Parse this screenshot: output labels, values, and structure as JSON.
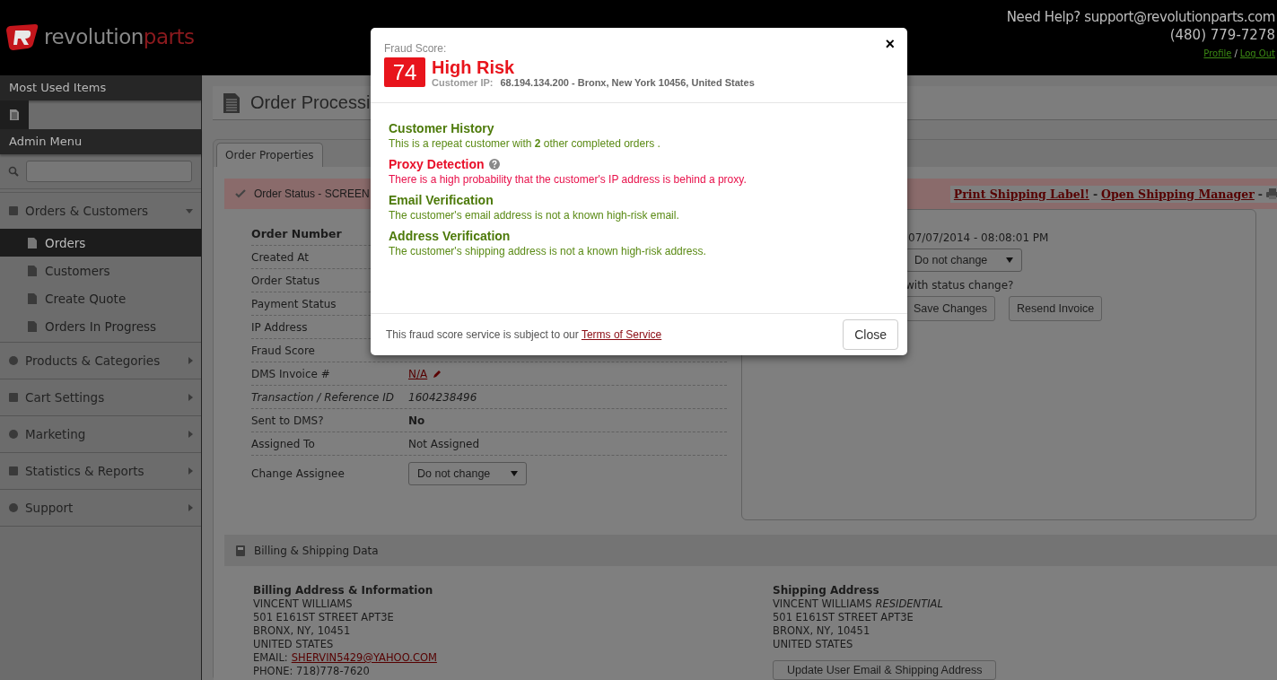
{
  "header": {
    "brand": "revolution",
    "brand_accent": "parts",
    "help_text": "Need Help? support@revolutionparts.com",
    "phone": "(480) 779-7278",
    "links": [
      {
        "label": "Profile"
      },
      {
        "label": "Log Out"
      }
    ],
    "separator": "/"
  },
  "sidebar": {
    "most_used_title": "Most Used Items",
    "admin_title": "Admin Menu",
    "menu": [
      {
        "label": "Orders & Customers",
        "expanded": true,
        "children": [
          {
            "label": "Orders",
            "selected": true
          },
          {
            "label": "Customers",
            "selected": false
          },
          {
            "label": "Create Quote",
            "selected": false
          },
          {
            "label": "Orders In Progress",
            "selected": false
          }
        ]
      },
      {
        "label": "Products & Categories",
        "expanded": false
      },
      {
        "label": "Cart Settings",
        "expanded": false
      },
      {
        "label": "Marketing",
        "expanded": false
      },
      {
        "label": "Statistics & Reports",
        "expanded": false
      },
      {
        "label": "Support",
        "expanded": false
      }
    ]
  },
  "page": {
    "title": "Order Processi",
    "tabs": [
      {
        "label": "Order Properties",
        "selected": true
      }
    ],
    "status_bar": {
      "text": "Order Status - SCREEN",
      "links": [
        {
          "label": "Print Shipping Label!",
          "after": "-"
        },
        {
          "label": "Open Shipping Manager",
          "after": "-"
        }
      ]
    },
    "properties": [
      {
        "label": "Order Number",
        "kind": "heading"
      },
      {
        "label": "Created At",
        "kind": "empty"
      },
      {
        "label": "Order Status",
        "kind": "empty"
      },
      {
        "label": "Payment Status",
        "kind": "empty"
      },
      {
        "label": "IP Address",
        "kind": "empty"
      },
      {
        "label": "Fraud Score",
        "kind": "empty"
      },
      {
        "label": "DMS Invoice #",
        "kind": "link",
        "value": "N/A"
      },
      {
        "label": "Transaction / Reference ID",
        "kind": "italic",
        "value": "1604238496"
      },
      {
        "label": "Sent to DMS?",
        "kind": "bold",
        "value": "No"
      },
      {
        "label": "Assigned To",
        "kind": "text",
        "value": "Not Assigned"
      },
      {
        "label": "Change Assignee",
        "kind": "select",
        "value": "Do not change"
      }
    ],
    "status_panel": {
      "date": "07/07/2014 - 08:08:01 PM",
      "status_select": "Do not change",
      "notify_text": "with status change?",
      "buttons": [
        "Save Changes",
        "Resend Invoice"
      ]
    },
    "billing": {
      "title": "Billing & Shipping Data",
      "billing_address": {
        "heading": "Billing Address & Information",
        "lines": [
          "VINCENT WILLIAMS",
          "501 E161ST STREET APT3E",
          "BRONX, NY, 10451",
          "UNITED STATES"
        ],
        "email_label": "EMAIL:",
        "email": "SHERVIN5429@YAHOO.COM",
        "phone": "PHONE: 718)778-7620"
      },
      "shipping_address": {
        "heading": "Shipping Address",
        "name": "VINCENT WILLIAMS",
        "name_tag": "RESIDENTIAL",
        "lines": [
          "501 E161ST STREET APT3E",
          "BRONX, NY, 10451",
          "UNITED STATES"
        ],
        "button": "Update User Email & Shipping Address"
      }
    }
  },
  "modal": {
    "label": "Fraud Score:",
    "score": "74",
    "risk": "High Risk",
    "ip_label": "Customer IP:",
    "ip_value": "68.194.134.200 - Bronx, New York 10456, United States",
    "close_glyph": "×",
    "checks": [
      {
        "title": "Customer History",
        "text": "This is a repeat customer with **2** other completed orders .",
        "flagged": false,
        "help": false
      },
      {
        "title": "Proxy Detection",
        "text": "There is a high probability that the customer's IP address is behind a proxy.",
        "flagged": true,
        "help": true
      },
      {
        "title": "Email Verification",
        "text": "The customer's email address is not a known high-risk email.",
        "flagged": false,
        "help": false
      },
      {
        "title": "Address Verification",
        "text": "The customer's shipping address is not a known high-risk address.",
        "flagged": false,
        "help": false
      }
    ],
    "footer_text": "This fraud score service is subject to our",
    "terms_link": "Terms of Service",
    "close_button": "Close"
  }
}
